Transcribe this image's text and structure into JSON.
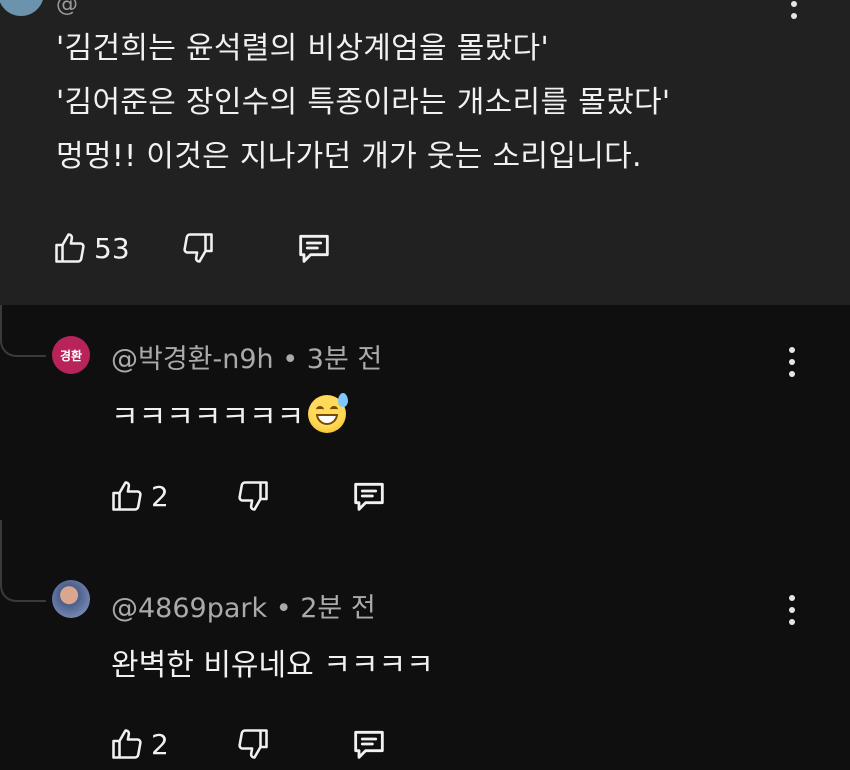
{
  "parent_comment": {
    "lines": [
      "'김건희는 윤석렬의 비상계엄을 몰랐다'",
      "'김어준은 장인수의 특종이라는 개소리를 몰랐다'",
      "멍멍!! 이것은 지나가던 개가 웃는 소리입니다."
    ],
    "likes": "53"
  },
  "replies": [
    {
      "avatar_text": "경환",
      "avatar_color": "#b8245a",
      "handle": "@박경환-n9h",
      "time": "3분 전",
      "text": "ㅋㅋㅋㅋㅋㅋㅋ",
      "emoji": "grinning-sweat-emoji",
      "likes": "2"
    },
    {
      "handle": "@4869park",
      "time": "2분 전",
      "text": "완벽한 비유네요 ㅋㅋㅋㅋ",
      "likes": "2"
    }
  ],
  "icons": {
    "like": "thumbs-up-icon",
    "dislike": "thumbs-down-icon",
    "reply": "reply-icon",
    "more": "more-vertical-icon"
  }
}
